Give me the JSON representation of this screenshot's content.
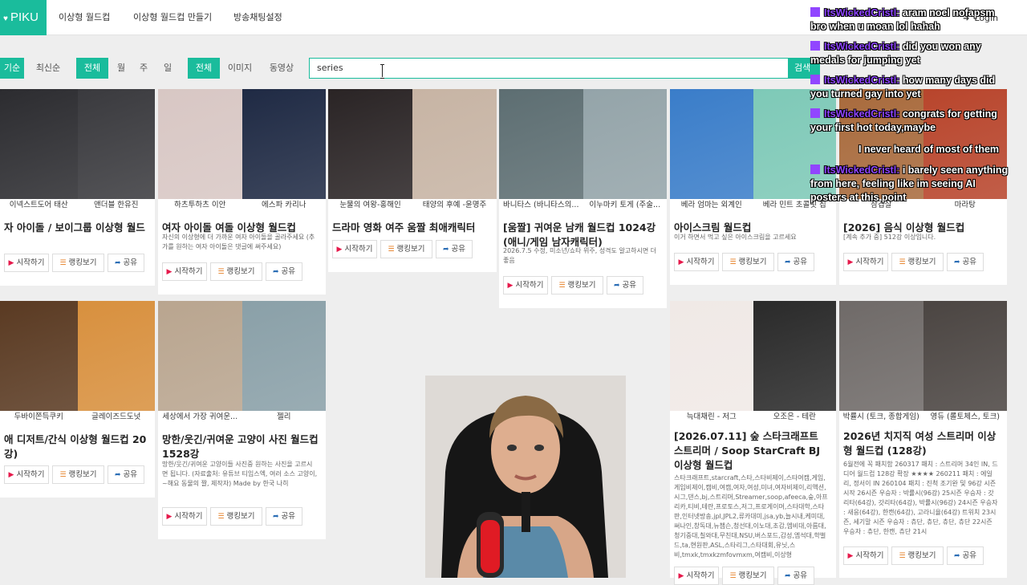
{
  "nav": {
    "logo": "PIKU",
    "links": [
      "이상형 월드컵",
      "이상형 월드컵 만들기",
      "방송채팅설정"
    ],
    "login": "Login"
  },
  "filters": {
    "sort": [
      "기순",
      "최신순"
    ],
    "period": [
      "전체",
      "월",
      "주",
      "일"
    ],
    "media": [
      "전체",
      "이미지",
      "동영상"
    ]
  },
  "search": {
    "value": "series",
    "button": "검색"
  },
  "buttons": {
    "start": "시작하기",
    "rank": "랭킹보기",
    "share": "공유"
  },
  "cards": [
    {
      "captions": [
        "이넥스트도어 태산",
        "앤더블 한유진"
      ],
      "title": "자 아이돌 / 보이그룹 이상형 월드",
      "desc": "",
      "colors": [
        "#2c2c30",
        "#3a3a3e"
      ]
    },
    {
      "captions": [
        "하츠투하츠 이안",
        "에스파 카리나"
      ],
      "title": "여자 아이돌 여돌 이상형 월드컵",
      "desc": "자신의 이상형에 더 가까운 여자 아이돌을 골라주세요 (추가를 원하는 여자 아이돌은 댓글에 써주세요)",
      "colors": [
        "#d8c7c4",
        "#1f2a44"
      ]
    },
    {
      "captions": [
        "눈물의 여왕-홍해인",
        "태양의 후예 -윤명주"
      ],
      "title": "드라마 영화 여주 움짤 최애캐릭터",
      "desc": "",
      "colors": [
        "#2a2425",
        "#c7b4a4"
      ]
    },
    {
      "captions": [
        "바니타스 (바니타스의...",
        "이누마키 토게 (주술..."
      ],
      "title": "[움짤] 귀여운 남캐 월드컵 1024강 (애니/게임 남자캐릭터)",
      "desc": "2026.7.5 수정, 미소년/쇼타 위주, 성격도 알고하시면 더 좋음",
      "colors": [
        "#5d6e72",
        "#94a4a9"
      ]
    },
    {
      "captions": [
        "베라 엄마는 외계인",
        "베라 민트 초콜릿 칩"
      ],
      "title": "아이스크림 월드컵",
      "desc": "이거 하면서 먹고 싶은 아이스크림을 고르세요",
      "colors": [
        "#3a7dc9",
        "#7ec9b7"
      ]
    },
    {
      "captions": [
        "삼겹살",
        "마라탕"
      ],
      "title": "[2026] 음식 이상형 월드컵",
      "desc": "[계속 추가 중] 512강 이상입니다.",
      "colors": [
        "#a86a3c",
        "#b8452c"
      ]
    },
    {
      "captions": [
        "두바이쫀득쿠키",
        "글레이즈드도넛"
      ],
      "title": "애 디저트/간식 이상형 월드컵 20강)",
      "desc": "",
      "colors": [
        "#5a3a22",
        "#d8903e"
      ]
    },
    {
      "captions": [
        "세상에서 가장 귀여운...",
        "젤리"
      ],
      "title": "망한/웃긴/귀여운 고양이 사진 월드컵 1528강",
      "desc": "망한/웃긴/귀여운 고양이들 사진중 원하는 사진을 고르시면 됩니다. (자료출처: 유튜브 티임스엑, 여러 소스 고양이, ~해요 동물의 짤, 제작자) Made by 한국 나히",
      "colors": [
        "#b9a58f",
        "#8aa0a8"
      ]
    },
    {
      "captions": [
        "늑대채린 - 저그",
        "오조은 - 테란"
      ],
      "title": "[2026.07.11] 숲 스타크래프트 스트리머 / Soop StarCraft BJ 이상형 월드컵",
      "desc": "스타크래프트,starcraft,스타,스타비제이,스타여캠,게임,게임비제이,캠비,여캠,여자,여성,미녀,여자비제이,리액션,시그,댄스,bj,스트리머,Streamer,soop,afeeca,숲,아프리카,티비,테란,프로토스,저그,프로게이머,스타대학,스타판,인터넷방송,jpl,JPL2,류카대미,jsa,yb,늘시내,케미대,써나인,창독대,뉴챔슨,청선대,이노대,초감,엠비대,아름대,청기중대,칠와대,무친대,NSU,버스포드,감성,엠석대,학벌드,ta,현원판,ASL,스타리그,스타대회,유닛,스비,tmxk,tmxkzmfovmxm,여캠비,이상형",
      "colors": [
        "#f0e9e6",
        "#2a2a2a"
      ]
    },
    {
      "captions": [
        "박률시 (토크, 종합게임)",
        "영듀 (롤토체스, 토크)"
      ],
      "title": "2026년 치지직 여성 스트리머 이상형 월드컵 (128강)",
      "desc": "6월전에 꼭 패치함 260317 패치 : 스트리머 34인 IN, 드디어 월드컵 128강 확장 ★★★★ 260211 패치 : 에일리, 정서이 IN 260104 패치 : 진척 조기완 및 96강 시즌 시작 26시즌 우승자 : 박률시(96강) 25시즌 우승자 : 갓리타(64강), 갓리타(64강), 박률시(96강) 24시즌 우승자 : 새응(64강), 한캔(64강), 고라니율(64강) 트위치 23시즌, 세기말 시즌 우승자 : 츄단, 츄단, 츄단, 츄단 22시즌 우승자 : 츄단, 한캔, 츄단 21시",
      "colors": [
        "#6f6a68",
        "#4b4542"
      ]
    }
  ],
  "chat": [
    {
      "user": "ItsWickedCristl:",
      "text": " aram noel nofapsm bro when u moan lol hahah"
    },
    {
      "user": "ItsWickedCristl:",
      "text": " did you won any medals for jumping yet"
    },
    {
      "user": "ItsWickedCristl:",
      "text": " how many days did you turned gay into yet"
    },
    {
      "user": "ItsWickedCristl:",
      "text": " congrats for getting your first hot today,maybe"
    },
    {
      "user": "",
      "text": "I never heard of most of them"
    },
    {
      "user": "ItsWickedCristl:",
      "text": " i barely seen anything from here, feeling like im seeing AI posters at this point"
    }
  ]
}
